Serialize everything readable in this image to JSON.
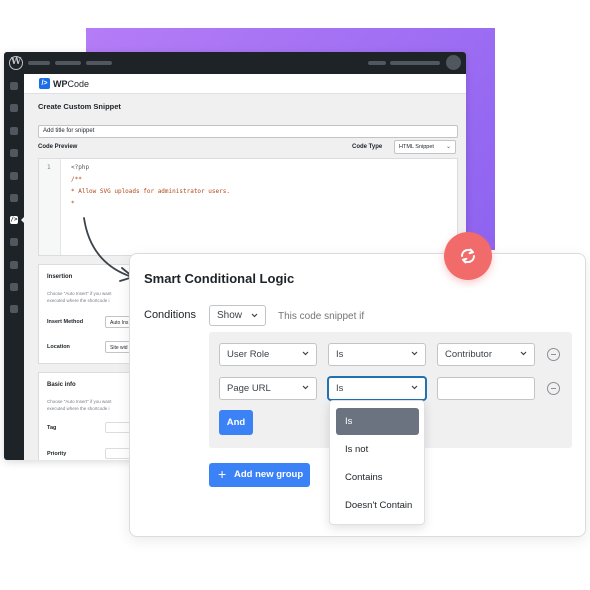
{
  "app": {
    "logo_text": "W",
    "brand_name": "WP",
    "brand_suffix": "Code",
    "brand_icon": "/>"
  },
  "editor": {
    "page_title": "Create Custom Snippet",
    "title_placeholder": "Add title for snippet",
    "code_preview_label": "Code Preview",
    "code_type_label": "Code Type",
    "code_type_value": "HTML Snippet",
    "line_number": "1",
    "code_lines": [
      "<?php",
      "/**",
      "* Allow SVG uploads for administrator users.",
      "*"
    ]
  },
  "insertion_panel": {
    "title": "Insertion",
    "description": [
      "Choose \"Auto Insert\" if you want",
      "executed where the shortcode i"
    ],
    "insert_method_label": "Insert Method",
    "insert_method_value": "Auto Ins",
    "location_label": "Location",
    "location_value": "Site wid"
  },
  "basic_info_panel": {
    "title": "Basic info",
    "description": [
      "Choose \"Auto Insert\" if you want",
      "executed where the shortcode i"
    ],
    "tag_label": "Tag",
    "priority_label": "Priority"
  },
  "conditional_logic": {
    "title": "Smart Conditional Logic",
    "conditions_label": "Conditions",
    "show_value": "Show",
    "snippet_if_text": "This code snippet if",
    "rules": [
      {
        "field": "User Role",
        "operator": "Is",
        "value": "Contributor"
      },
      {
        "field": "Page URL",
        "operator": "Is",
        "value": ""
      }
    ],
    "and_label": "And",
    "add_group_label": "Add new group",
    "operator_options": [
      "Is",
      "Is not",
      "Contains",
      "Doesn't Contain"
    ],
    "selected_option": "Is"
  },
  "colors": {
    "accent_blue": "#3b82f6",
    "badge_red": "#f26b6b",
    "purple": "#8d63f0",
    "wp_dark": "#1d2327"
  },
  "icons": {
    "refresh": "refresh-icon",
    "chevron": "chevron-down-icon",
    "remove": "minus-circle-icon",
    "plus": "plus-icon"
  }
}
